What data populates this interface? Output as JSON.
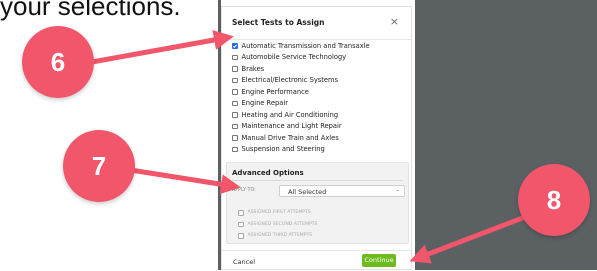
{
  "caption": "your selections.",
  "modal": {
    "title": "Select Tests to Assign",
    "close_label": "×",
    "tests": [
      {
        "label": "Automatic Transmission and Transaxle",
        "checked": true
      },
      {
        "label": "Automobile Service Technology",
        "checked": false
      },
      {
        "label": "Brakes",
        "checked": false
      },
      {
        "label": "Electrical/Electronic Systems",
        "checked": false
      },
      {
        "label": "Engine Performance",
        "checked": false
      },
      {
        "label": "Engine Repair",
        "checked": false
      },
      {
        "label": "Heating and Air Conditioning",
        "checked": false
      },
      {
        "label": "Maintenance and Light Repair",
        "checked": false
      },
      {
        "label": "Manual Drive Train and Axles",
        "checked": false
      },
      {
        "label": "Suspension and Steering",
        "checked": false
      }
    ],
    "advanced": {
      "title": "Advanced Options",
      "apply_label": "APPLY TO:",
      "apply_value": "All Selected",
      "attempts": [
        {
          "label": "ASSIGNED FIRST ATTEMPTS",
          "checked": false
        },
        {
          "label": "ASSIGNED SECOND ATTEMPTS",
          "checked": false
        },
        {
          "label": "ASSIGNED THIRD ATTEMPTS",
          "checked": false
        }
      ]
    },
    "footer": {
      "cancel_label": "Cancel",
      "continue_label": "Continue"
    }
  },
  "callouts": [
    "6",
    "7",
    "8"
  ],
  "colors": {
    "callout": "#f2566b",
    "continue": "#6dbb1f",
    "checkbox_checked": "#2a6ce0",
    "backdrop": "#5b6063"
  }
}
